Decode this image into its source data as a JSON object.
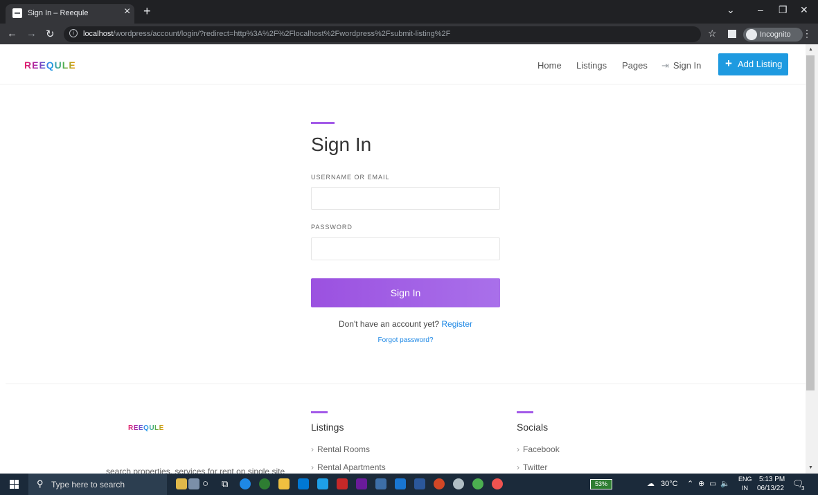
{
  "browser": {
    "tab_title": "Sign In – Reequle",
    "url_host": "localhost",
    "url_path": "/wordpress/account/login/?redirect=http%3A%2F%2Flocalhost%2Fwordpress%2Fsubmit-listing%2F",
    "incognito_label": "Incognito"
  },
  "header": {
    "logo": "REEQULE",
    "nav": [
      "Home",
      "Listings",
      "Pages",
      "Sign In"
    ],
    "add_listing": "Add Listing"
  },
  "form": {
    "title": "Sign In",
    "username_label": "USERNAME OR EMAIL",
    "password_label": "PASSWORD",
    "username_value": "",
    "password_value": "",
    "submit": "Sign In",
    "no_account_text": "Don't have an account yet?",
    "register_link": "Register",
    "forgot_link": "Forgot password?"
  },
  "footer": {
    "logo": "REEQULE",
    "tagline": "search properties, services for rent on single site",
    "listings_heading": "Listings",
    "listings_links": [
      "Rental Rooms",
      "Rental Apartments"
    ],
    "socials_heading": "Socials",
    "socials_links": [
      "Facebook",
      "Twitter"
    ]
  },
  "taskbar": {
    "search_placeholder": "Type here to search",
    "battery": "53%",
    "weather": "30°C",
    "lang_top": "ENG",
    "lang_bottom": "IN",
    "time": "5:13 PM",
    "date": "06/13/22",
    "notification_count": "3"
  },
  "colors": {
    "accent": "#a259e8",
    "link": "#1e88e5",
    "add_listing_bg": "#1e9ae0"
  }
}
